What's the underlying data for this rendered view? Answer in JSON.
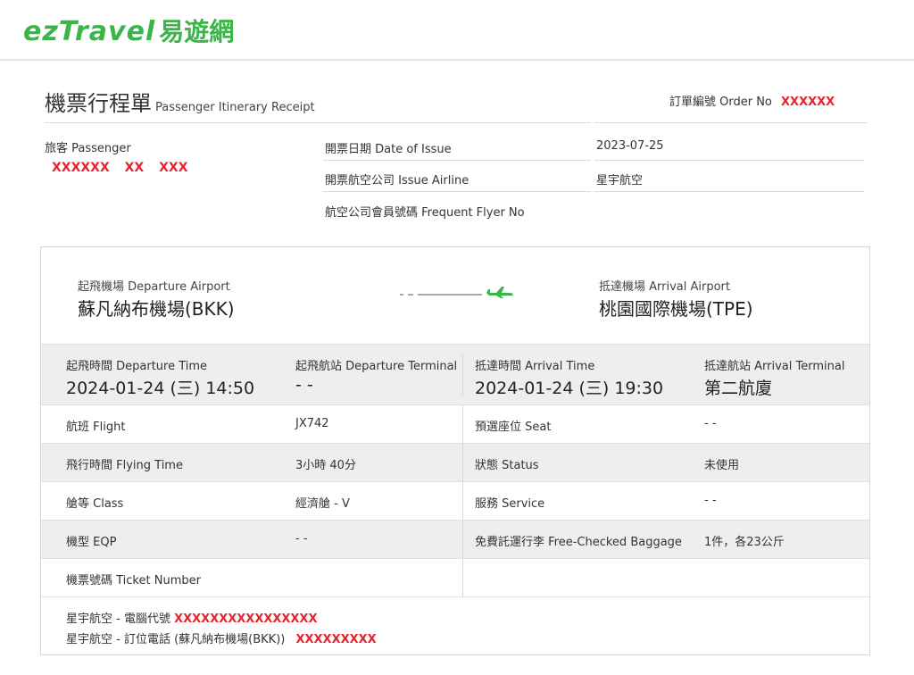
{
  "logo": {
    "en": "ezTravel",
    "zh": "易遊網"
  },
  "title": {
    "zh": "機票行程單",
    "en": "Passenger Itinerary Receipt"
  },
  "order": {
    "label": "訂單編號 Order No",
    "value": "XXXXXX"
  },
  "passenger": {
    "label": "旅客 Passenger",
    "name": "XXXXXX XX XXX"
  },
  "issue": {
    "date_label": "開票日期 Date of Issue",
    "date_value": "2023-07-25",
    "airline_label": "開票航空公司 Issue Airline",
    "airline_value": "星宇航空",
    "ffn_label": "航空公司會員號碼 Frequent Flyer No",
    "ffn_value": ""
  },
  "route": {
    "dep_label": "起飛機場 Departure Airport",
    "dep_name": "蘇凡納布機場(BKK)",
    "arr_label": "抵達機場 Arrival Airport",
    "arr_name": "桃園國際機場(TPE)"
  },
  "times": {
    "dep_time_label": "起飛時間 Departure Time",
    "dep_time": "2024-01-24 (三) 14:50",
    "dep_term_label": "起飛航站 Departure Terminal",
    "dep_term": "- -",
    "arr_time_label": "抵達時間 Arrival Time",
    "arr_time": "2024-01-24 (三) 19:30",
    "arr_term_label": "抵達航站 Arrival Terminal",
    "arr_term": "第二航廈"
  },
  "rows": [
    {
      "l1": "航班 Flight",
      "v1": "JX742",
      "l2": "預選座位 Seat",
      "v2": "- -"
    },
    {
      "l1": "飛行時間 Flying Time",
      "v1": "3小時 40分",
      "l2": "狀態 Status",
      "v2": "未使用"
    },
    {
      "l1": "艙等 Class",
      "v1": "經濟艙 - V",
      "l2": "服務 Service",
      "v2": "- -"
    },
    {
      "l1": "機型 EQP",
      "v1": "- -",
      "l2": "免費託運行李 Free-Checked Baggage",
      "v2": "1件，各23公斤"
    },
    {
      "l1": "機票號碼 Ticket Number",
      "v1": "",
      "l2": "",
      "v2": ""
    }
  ],
  "contacts": [
    {
      "label": "星宇航空 - 電腦代號",
      "value": "XXXXXXXXXXXXXXXX"
    },
    {
      "label": "星宇航空 - 訂位電話 (蘇凡納布機場(BKK))",
      "value": "XXXXXXXXX"
    }
  ],
  "colors": {
    "brand": "#3bb54a",
    "redact": "#e8232e",
    "row_gray": "#eeeeef"
  }
}
